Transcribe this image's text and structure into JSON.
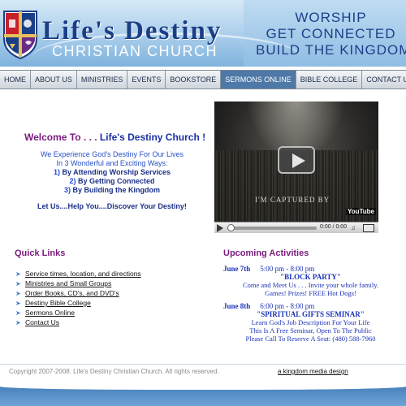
{
  "header": {
    "logo_title": "Life's Destiny",
    "logo_subtitle": "CHRISTIAN CHURCH",
    "tagline": [
      "WORSHIP",
      "GET CONNECTED",
      "BUILD THE KINGDOM"
    ],
    "colors": {
      "brand_blue": "#1b3f87",
      "header_light": "#d6e9f7",
      "header_dark": "#7fb2dd"
    }
  },
  "nav": {
    "items": [
      "HOME",
      "ABOUT US",
      "MINISTRIES",
      "EVENTS",
      "BOOKSTORE",
      "SERMONS ONLINE",
      "BIBLE COLLEGE",
      "CONTACT US"
    ],
    "active": "SERMONS ONLINE",
    "active_color": "#4e78a7"
  },
  "welcome": {
    "prefix": "Welcome To . . . ",
    "brand": "Life's Destiny Church",
    "suffix": " !",
    "intro_line1": "We Experience God's Destiny For Our Lives",
    "intro_line2": "In 3 Wonderful and Exciting Ways:",
    "steps": [
      {
        "num": "1)",
        "text": "By Attending Worship Services"
      },
      {
        "num": "2)",
        "text": "By Getting Connected"
      },
      {
        "num": "3)",
        "text": "By Building the Kingdom"
      }
    ],
    "motto": "Let Us....Help You....Discover Your Destiny!"
  },
  "video": {
    "caption": "I'M CAPTURED BY",
    "logo": "YouTube",
    "time": "0:00 / 0:00",
    "icons": [
      "play-icon",
      "volume-icon",
      "fullscreen-icon"
    ]
  },
  "quick_links": {
    "title": "Quick Links",
    "items": [
      "Service times, location, and directions",
      "Ministries and Small Groups",
      "Order Books, CD's, and DVD's",
      "Destiny Bible College",
      "Sermons Online",
      "Contact Us"
    ]
  },
  "activities": {
    "title": "Upcoming Activities",
    "events": [
      {
        "date": "June 7th",
        "time": "5:00 pm - 8:00 pm",
        "name": "\"BLOCK PARTY\"",
        "desc": [
          "Come and Meet Us . . . Invite your whole family.",
          "Games!  Prizes!  FREE Hot Dogs!"
        ]
      },
      {
        "date": "June 8th",
        "time": "6:00 pm - 8:00 pm",
        "name": "\"SPIRITUAL GIFTS SEMINAR\"",
        "desc": [
          "Learn God's Job Description For Your Life",
          "This Is A Free Seminar, Open To The Public",
          "Please Call To Reserve A Seat:  (480) 588-7960"
        ]
      }
    ]
  },
  "footer": {
    "copyright": "Copyright 2007-2008. Life's Destiny Christian Church. All rights reserved.",
    "credit": "a kingdom media design"
  }
}
